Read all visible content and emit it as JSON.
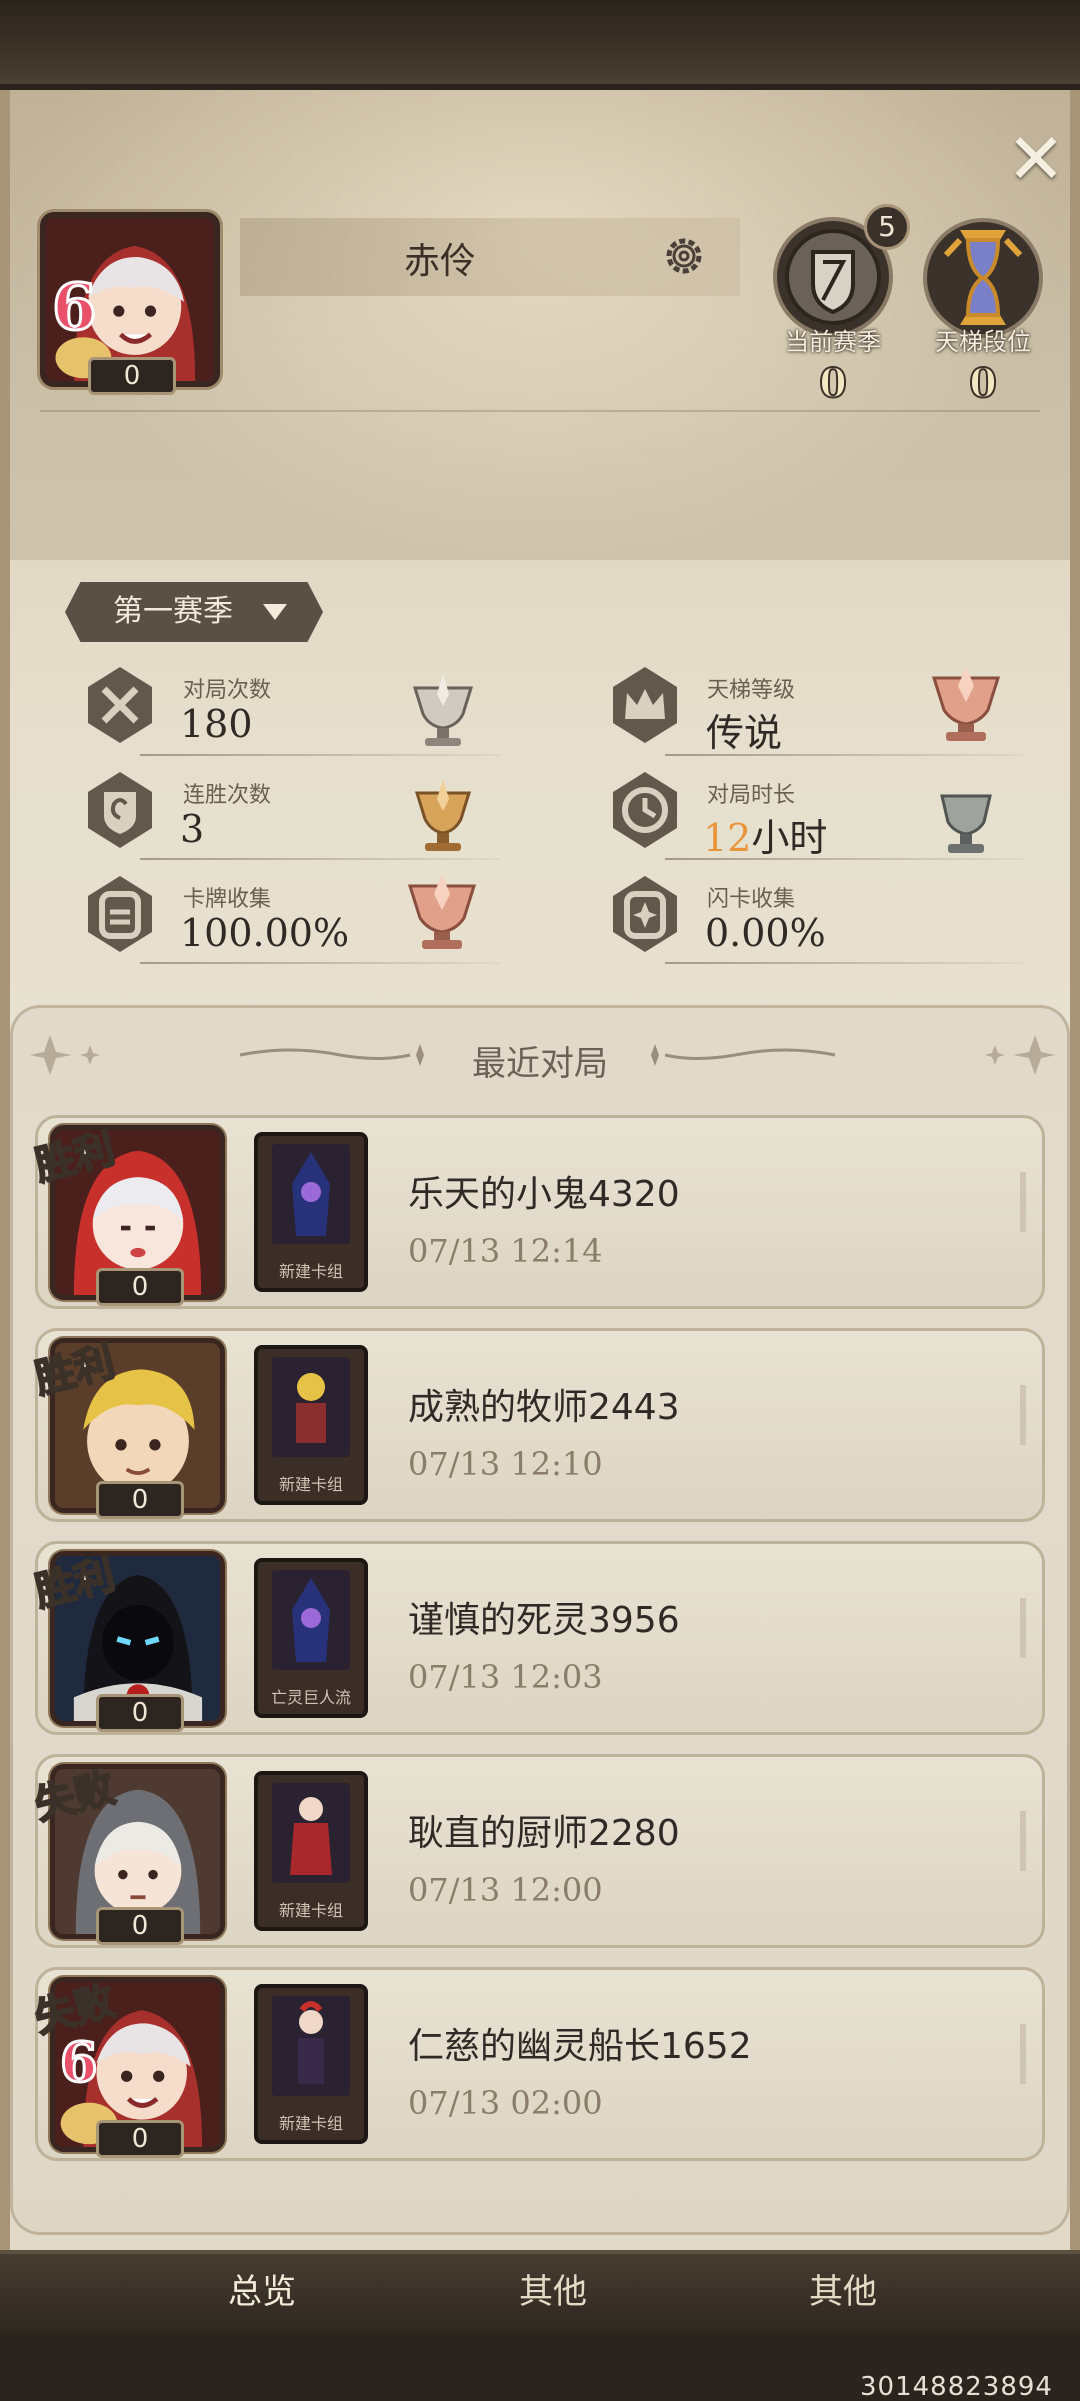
{
  "player": {
    "name": "赤伶",
    "level": "6",
    "avatar_count": "0"
  },
  "badges": {
    "season": {
      "label": "当前赛季",
      "value": "0",
      "rank": "5"
    },
    "ladder": {
      "label": "天梯段位",
      "value": "0"
    }
  },
  "season_select": {
    "label": "第一赛季"
  },
  "stats": [
    {
      "label": "对局次数",
      "value": "180",
      "icon": "crossed-swords-icon",
      "trophy": "silver-trophy-icon"
    },
    {
      "label": "天梯等级",
      "value": "传说",
      "icon": "crown-icon",
      "trophy": "rose-gold-trophy-icon"
    },
    {
      "label": "连胜次数",
      "value": "3",
      "icon": "shield-emblem-icon",
      "trophy": "bronze-trophy-icon"
    },
    {
      "label": "对局时长",
      "value_num": "12",
      "value_unit": "小时",
      "icon": "clock-icon",
      "trophy": "iron-trophy-icon"
    },
    {
      "label": "卡牌收集",
      "value": "100.00%",
      "icon": "card-collection-icon",
      "trophy": "rose-gold-trophy-icon"
    },
    {
      "label": "闪卡收集",
      "value": "0.00%",
      "icon": "shiny-card-icon",
      "trophy": "none"
    }
  ],
  "recent": {
    "title": "最近对局",
    "matches": [
      {
        "result": "胜利",
        "opponent": "乐天的小鬼4320",
        "time": "07/13 12:14",
        "count": "0",
        "deck": "新建卡组",
        "avatar": "red-hood-girl-icon"
      },
      {
        "result": "胜利",
        "opponent": "成熟的牧师2443",
        "time": "07/13 12:10",
        "count": "0",
        "deck": "新建卡组",
        "avatar": "blond-boy-icon"
      },
      {
        "result": "胜利",
        "opponent": "谨慎的死灵3956",
        "time": "07/13 12:03",
        "count": "0",
        "deck": "亡灵巨人流",
        "avatar": "hooded-necromancer-icon"
      },
      {
        "result": "失败",
        "opponent": "耿直的厨师2280",
        "time": "07/13 12:00",
        "count": "0",
        "deck": "新建卡组",
        "avatar": "grey-hood-child-icon"
      },
      {
        "result": "失败",
        "opponent": "仁慈的幽灵船长1652",
        "time": "07/13 02:00",
        "count": "0",
        "deck": "新建卡组",
        "avatar": "red-hood-girl-icon"
      }
    ]
  },
  "tabs": [
    {
      "label": "总览"
    },
    {
      "label": "其他"
    },
    {
      "label": "其他"
    }
  ],
  "uid": "30148823894",
  "colors": {
    "accent_orange": "#e8953a",
    "lose_text": "#f4ecd8",
    "panel": "#e6dfcd"
  }
}
